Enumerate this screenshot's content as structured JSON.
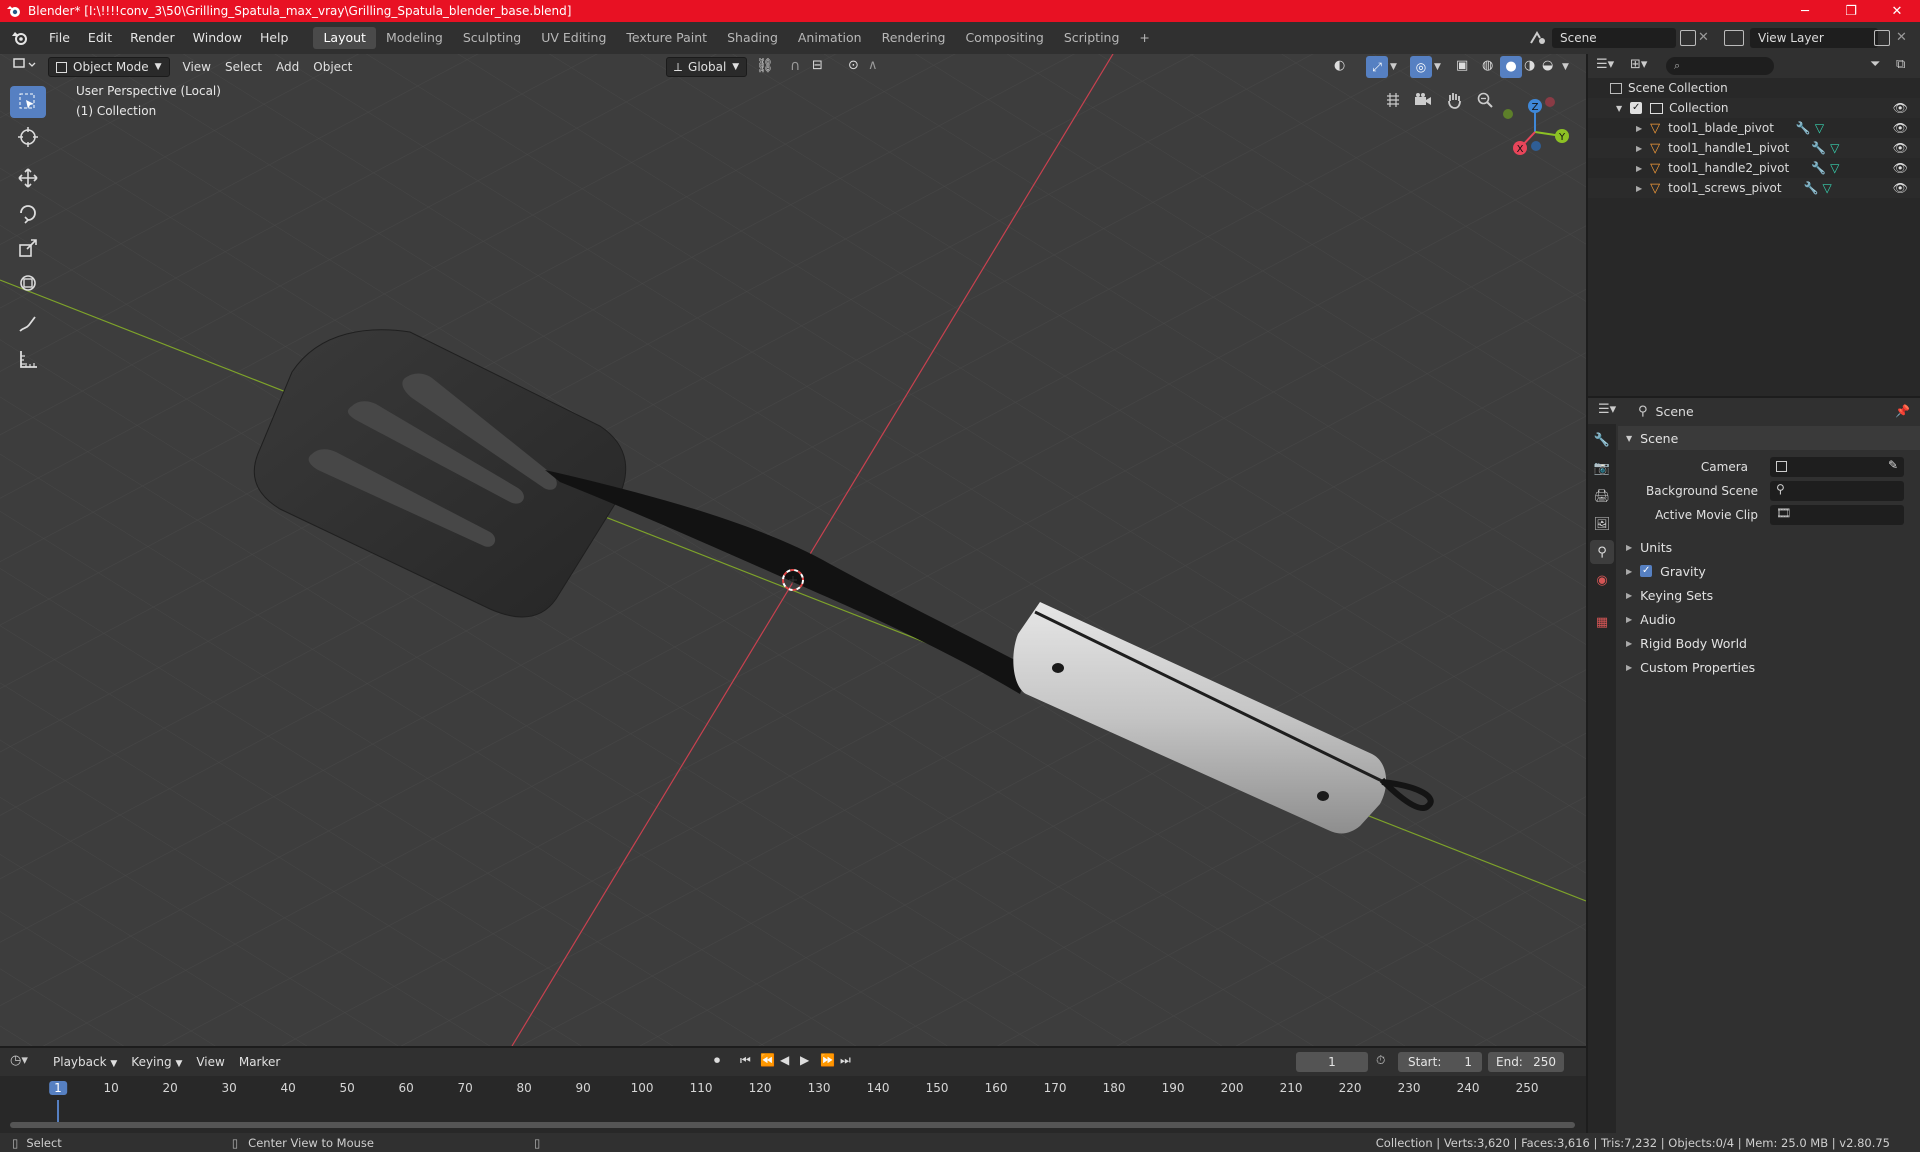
{
  "window": {
    "title": "Blender* [I:\\!!!!conv_3\\50\\Grilling_Spatula_max_vray\\Grilling_Spatula_blender_base.blend]",
    "minimize": "─",
    "maximize": "❐",
    "close": "✕"
  },
  "menu": [
    "File",
    "Edit",
    "Render",
    "Window",
    "Help"
  ],
  "workspaces": [
    "Layout",
    "Modeling",
    "Sculpting",
    "UV Editing",
    "Texture Paint",
    "Shading",
    "Animation",
    "Rendering",
    "Compositing",
    "Scripting"
  ],
  "add_workspace": "+",
  "scene_name": "Scene",
  "view_layer": "View Layer",
  "viewport_header": {
    "mode": "Object Mode",
    "menus": [
      "View",
      "Select",
      "Add",
      "Object"
    ],
    "orientation": "Global"
  },
  "viewport": {
    "perspective": "User Perspective (Local)",
    "collection": "(1) Collection",
    "gizmo_axes": {
      "x": "X",
      "y": "Y",
      "z": "Z"
    }
  },
  "outliner": {
    "root": "Scene Collection",
    "collection": "Collection",
    "objects": [
      "tool1_blade_pivot",
      "tool1_handle1_pivot",
      "tool1_handle2_pivot",
      "tool1_screws_pivot"
    ]
  },
  "properties": {
    "header": "Scene",
    "panel": "Scene",
    "fields": [
      {
        "label": "Camera"
      },
      {
        "label": "Background Scene"
      },
      {
        "label": "Active Movie Clip"
      }
    ],
    "sections": [
      "Units",
      "Gravity",
      "Keying Sets",
      "Audio",
      "Rigid Body World",
      "Custom Properties"
    ]
  },
  "timeline": {
    "menus": [
      "Playback",
      "Keying",
      "View",
      "Marker"
    ],
    "current_frame": "1",
    "start_label": "Start:",
    "start": "1",
    "end_label": "End:",
    "end": "250",
    "ruler": [
      "1",
      "10",
      "20",
      "30",
      "40",
      "50",
      "60",
      "70",
      "80",
      "90",
      "100",
      "110",
      "120",
      "130",
      "140",
      "150",
      "160",
      "170",
      "180",
      "190",
      "200",
      "210",
      "220",
      "230",
      "240",
      "250"
    ]
  },
  "statusbar": {
    "select": "Select",
    "center": "Center View to Mouse",
    "stats": "Collection | Verts:3,620 | Faces:3,616 | Tris:7,232 | Objects:0/4 | Mem: 25.0 MB | v2.80.75"
  },
  "colors": {
    "title_bar": "#e81123",
    "accent": "#5680c2",
    "axis_x": "#e8455a",
    "axis_y": "#8cc124",
    "axis_z": "#3f88d8",
    "object_icon": "#f29a38"
  }
}
